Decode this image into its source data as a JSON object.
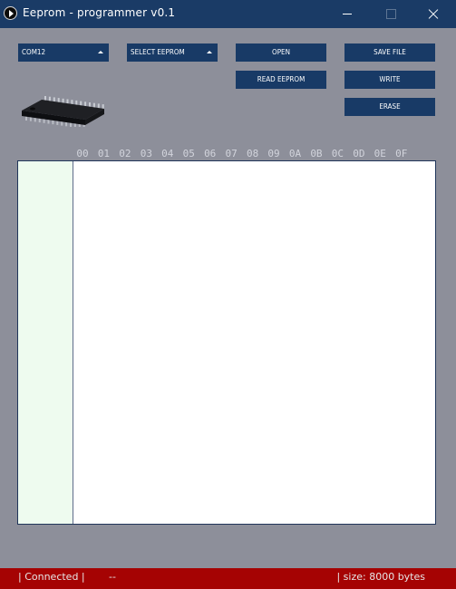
{
  "window": {
    "title": "Eeprom - programmer  v0.1",
    "icon": "play-icon"
  },
  "toolbar": {
    "port_select": {
      "value": "COM12",
      "icon": "caret-up-icon"
    },
    "eeprom_select": {
      "value": "SELECT EEPROM",
      "icon": "caret-up-icon"
    },
    "open_label": "OPEN",
    "read_label": "READ EEPROM",
    "save_label": "SAVE FILE",
    "write_label": "WRITE",
    "erase_label": "ERASE"
  },
  "chip_image": {
    "icon": "dip-chip-icon"
  },
  "hex_header": {
    "columns": [
      "00",
      "01",
      "02",
      "03",
      "04",
      "05",
      "06",
      "07",
      "08",
      "09",
      "0A",
      "0B",
      "0C",
      "0D",
      "0E",
      "0F"
    ]
  },
  "status": {
    "connection": "| Connected |",
    "detail": "--",
    "size": "| size: 8000 bytes"
  },
  "colors": {
    "title_bar": "#1a3b66",
    "button": "#183a66",
    "window_bg": "#8d8f9a",
    "address_column": "#eefbef",
    "status_bar": "#a50303"
  }
}
